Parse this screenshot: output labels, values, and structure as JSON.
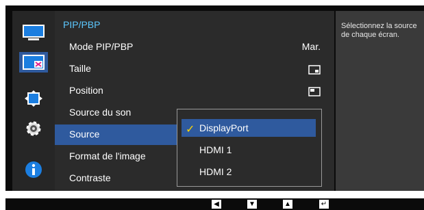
{
  "menu": {
    "title": "PIP/PBP",
    "items": [
      {
        "label": "Mode PIP/PBP",
        "value": "Mar."
      },
      {
        "label": "Taille",
        "value": ""
      },
      {
        "label": "Position",
        "value": ""
      },
      {
        "label": "Source du son",
        "value": ""
      },
      {
        "label": "Source",
        "value": ""
      },
      {
        "label": "Format de l'image",
        "value": ""
      },
      {
        "label": "Contraste",
        "value": ""
      }
    ]
  },
  "dropdown": {
    "options": [
      "DisplayPort",
      "HDMI 1",
      "HDMI 2"
    ],
    "selected": "DisplayPort",
    "check": "✓"
  },
  "help": {
    "text": "Sélectionnez la source de chaque écran."
  },
  "sidebar": {
    "icons": [
      "picture-icon",
      "pip-icon",
      "onscreen-display-icon",
      "system-gear-icon",
      "information-icon"
    ]
  },
  "footer": {
    "keys": [
      "◀",
      "▼",
      "▲",
      "↵"
    ]
  },
  "colors": {
    "accent": "#5cc8ff",
    "selection": "#2f5a9e",
    "check": "#ffd700",
    "background": "#0b0b0b"
  }
}
